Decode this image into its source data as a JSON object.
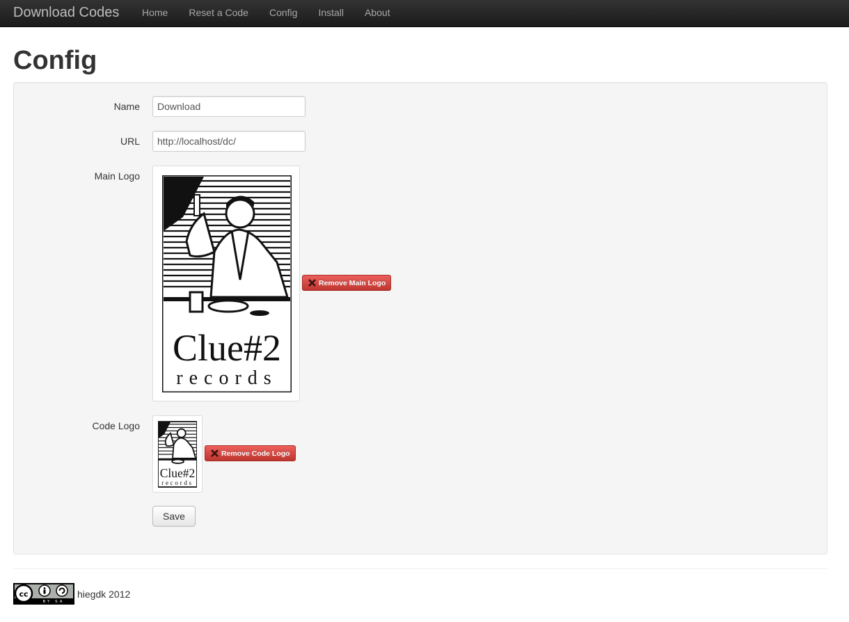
{
  "navbar": {
    "brand": "Download Codes",
    "items": [
      {
        "label": "Home"
      },
      {
        "label": "Reset a Code"
      },
      {
        "label": "Config"
      },
      {
        "label": "Install"
      },
      {
        "label": "About"
      }
    ]
  },
  "page": {
    "title": "Config"
  },
  "form": {
    "name_label": "Name",
    "name_value": "Download",
    "url_label": "URL",
    "url_value": "http://localhost/dc/",
    "main_logo_label": "Main Logo",
    "remove_main_logo": "Remove Main Logo",
    "code_logo_label": "Code Logo",
    "remove_code_logo": "Remove Code Logo",
    "save_label": "Save"
  },
  "logo": {
    "brand_line1": "Clue#2",
    "brand_line2": "records"
  },
  "footer": {
    "license_text": "BY SA",
    "credit": "hiegdk 2012"
  },
  "colors": {
    "danger": "#d9534f",
    "navbar": "#222222",
    "well": "#f5f5f5"
  }
}
